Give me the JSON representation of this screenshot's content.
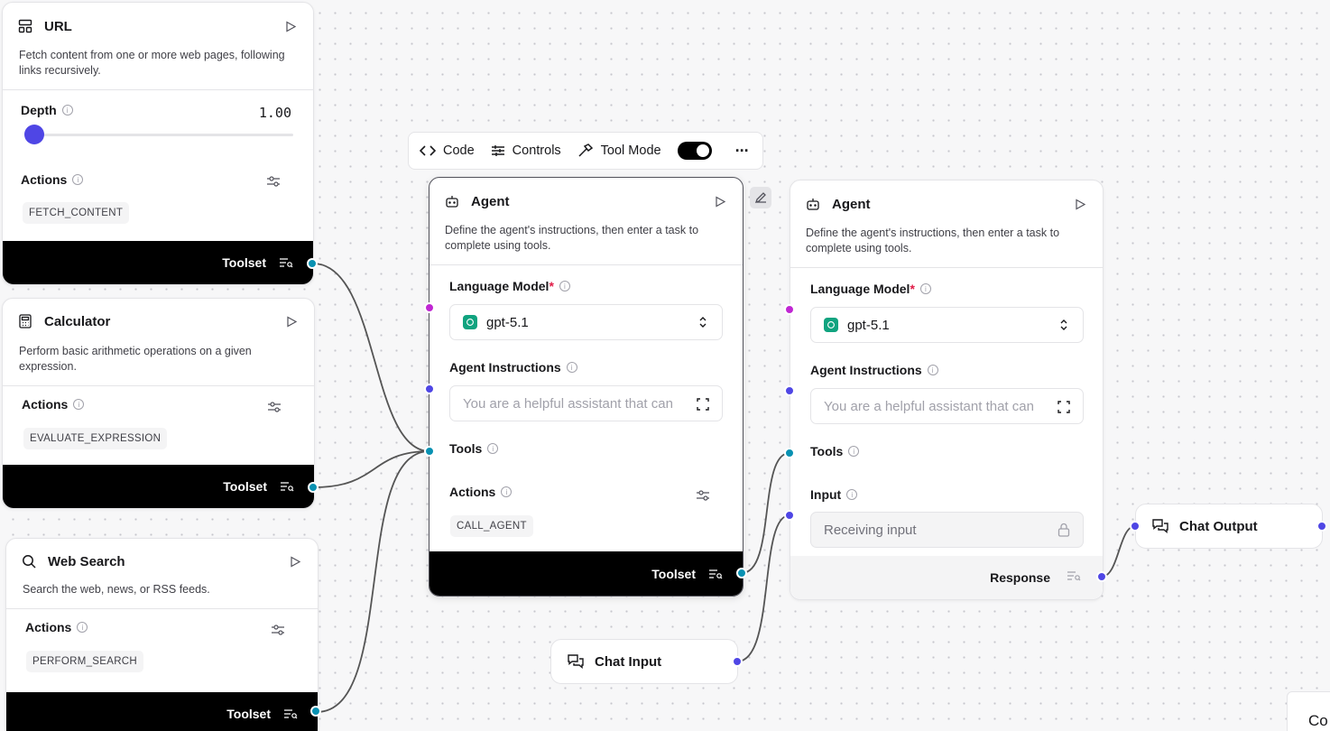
{
  "toolbar": {
    "code": "Code",
    "controls": "Controls",
    "tool_mode": "Tool Mode",
    "more": "···"
  },
  "url_node": {
    "title": "URL",
    "description": "Fetch content from one or more web pages, following links recursively.",
    "depth_label": "Depth",
    "depth_value": "1.00",
    "depth_fraction": 0.0,
    "actions_label": "Actions",
    "action_badge": "FETCH_CONTENT",
    "toolset": "Toolset"
  },
  "calculator_node": {
    "title": "Calculator",
    "description": "Perform basic arithmetic operations on a given expression.",
    "actions_label": "Actions",
    "action_badge": "EVALUATE_EXPRESSION",
    "toolset": "Toolset"
  },
  "websearch_node": {
    "title": "Web Search",
    "description": "Search the web, news, or RSS feeds.",
    "actions_label": "Actions",
    "action_badge": "PERFORM_SEARCH",
    "toolset": "Toolset"
  },
  "agent_node_1": {
    "title": "Agent",
    "description": "Define the agent's instructions, then enter a task to complete using tools.",
    "model_label": "Language Model",
    "required": "*",
    "model_value": "gpt-5.1",
    "instructions_label": "Agent Instructions",
    "instructions_placeholder": "You are a helpful assistant that can",
    "tools_label": "Tools",
    "actions_label": "Actions",
    "action_badge": "CALL_AGENT",
    "toolset": "Toolset"
  },
  "agent_node_2": {
    "title": "Agent",
    "description": "Define the agent's instructions, then enter a task to complete using tools.",
    "model_label": "Language Model",
    "required": "*",
    "model_value": "gpt-5.1",
    "instructions_label": "Agent Instructions",
    "instructions_placeholder": "You are a helpful assistant that can",
    "tools_label": "Tools",
    "input_label": "Input",
    "input_placeholder": "Receiving input",
    "response": "Response"
  },
  "chat_input": {
    "title": "Chat Input"
  },
  "chat_output": {
    "title": "Chat Output"
  },
  "corner": {
    "text": "Co"
  },
  "colors": {
    "teal": "#0891b2",
    "blue": "#4f46e5",
    "purple": "#c026d3",
    "openai_green": "#10a37f"
  }
}
